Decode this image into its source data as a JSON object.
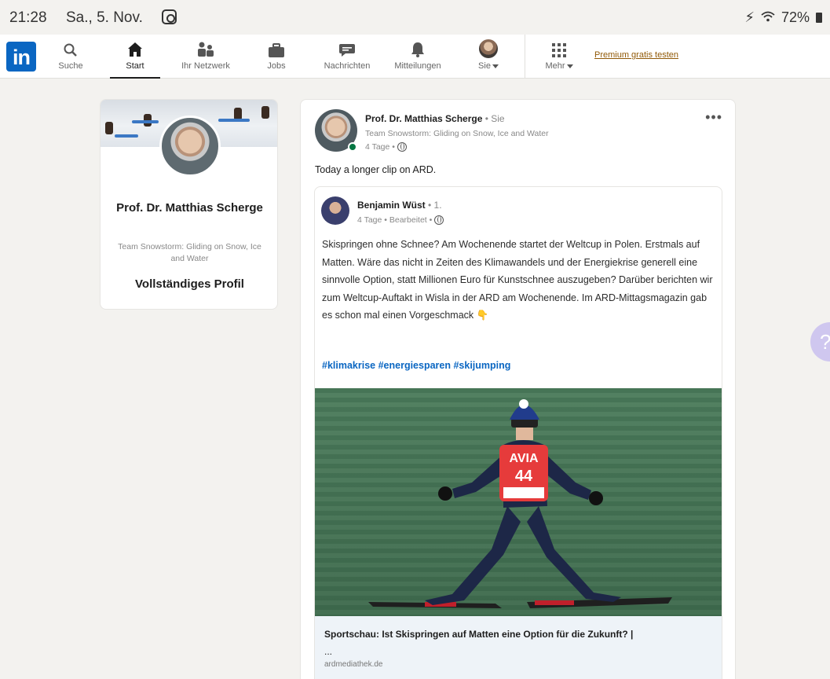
{
  "status_bar": {
    "time": "21:28",
    "date": "Sa., 5. Nov.",
    "battery": "72%"
  },
  "nav": {
    "items": [
      {
        "label": "Suche",
        "icon": "search-icon"
      },
      {
        "label": "Start",
        "icon": "home-icon",
        "active": true
      },
      {
        "label": "Ihr Netzwerk",
        "icon": "network-icon"
      },
      {
        "label": "Jobs",
        "icon": "briefcase-icon"
      },
      {
        "label": "Nachrichten",
        "icon": "messaging-icon"
      },
      {
        "label": "Mitteilungen",
        "icon": "bell-icon"
      },
      {
        "label": "Sie",
        "icon": "avatar"
      },
      {
        "label": "Mehr",
        "icon": "grid-icon"
      }
    ],
    "premium_link": "Premium gratis testen",
    "brand_color": "#0a66c2"
  },
  "profile": {
    "name": "Prof. Dr. Matthias Scherge",
    "headline": "Team Snowstorm: Gliding on Snow, Ice and Water",
    "full_profile_link": "Vollständiges Profil"
  },
  "post": {
    "author": "Prof. Dr. Matthias Scherge",
    "author_suffix": " • Sie",
    "headline": "Team Snowstorm: Gliding on Snow, Ice and Water",
    "meta": "4 Tage •",
    "more": "•••",
    "text": "Today a longer clip on ARD.",
    "shared": {
      "author": "Benjamin Wüst",
      "degree": " • 1.",
      "meta": "4 Tage • Bearbeitet •",
      "body": "Skispringen ohne Schnee? Am Wochenende startet der Weltcup in Polen. Erstmals auf Matten. Wäre das nicht in Zeiten des Klimawandels und der Energiekrise generell eine sinnvolle Option, statt Millionen Euro für Kunstschnee auszugeben? Darüber berichten wir zum Weltcup-Auftakt in Wisla in der ARD am Wochenende. Im ARD-Mittagsmagazin gab es schon mal einen Vorgeschmack",
      "hashtags": "#klimakrise #energiesparen #skijumping",
      "image": {
        "bib_sponsor": "AVIA",
        "bib_number": "44"
      },
      "link_title": "Sportschau: Ist Skispringen auf Matten eine Option für die Zukunft? |",
      "link_ellipsis": "...",
      "link_domain": "ardmediathek.de"
    }
  }
}
